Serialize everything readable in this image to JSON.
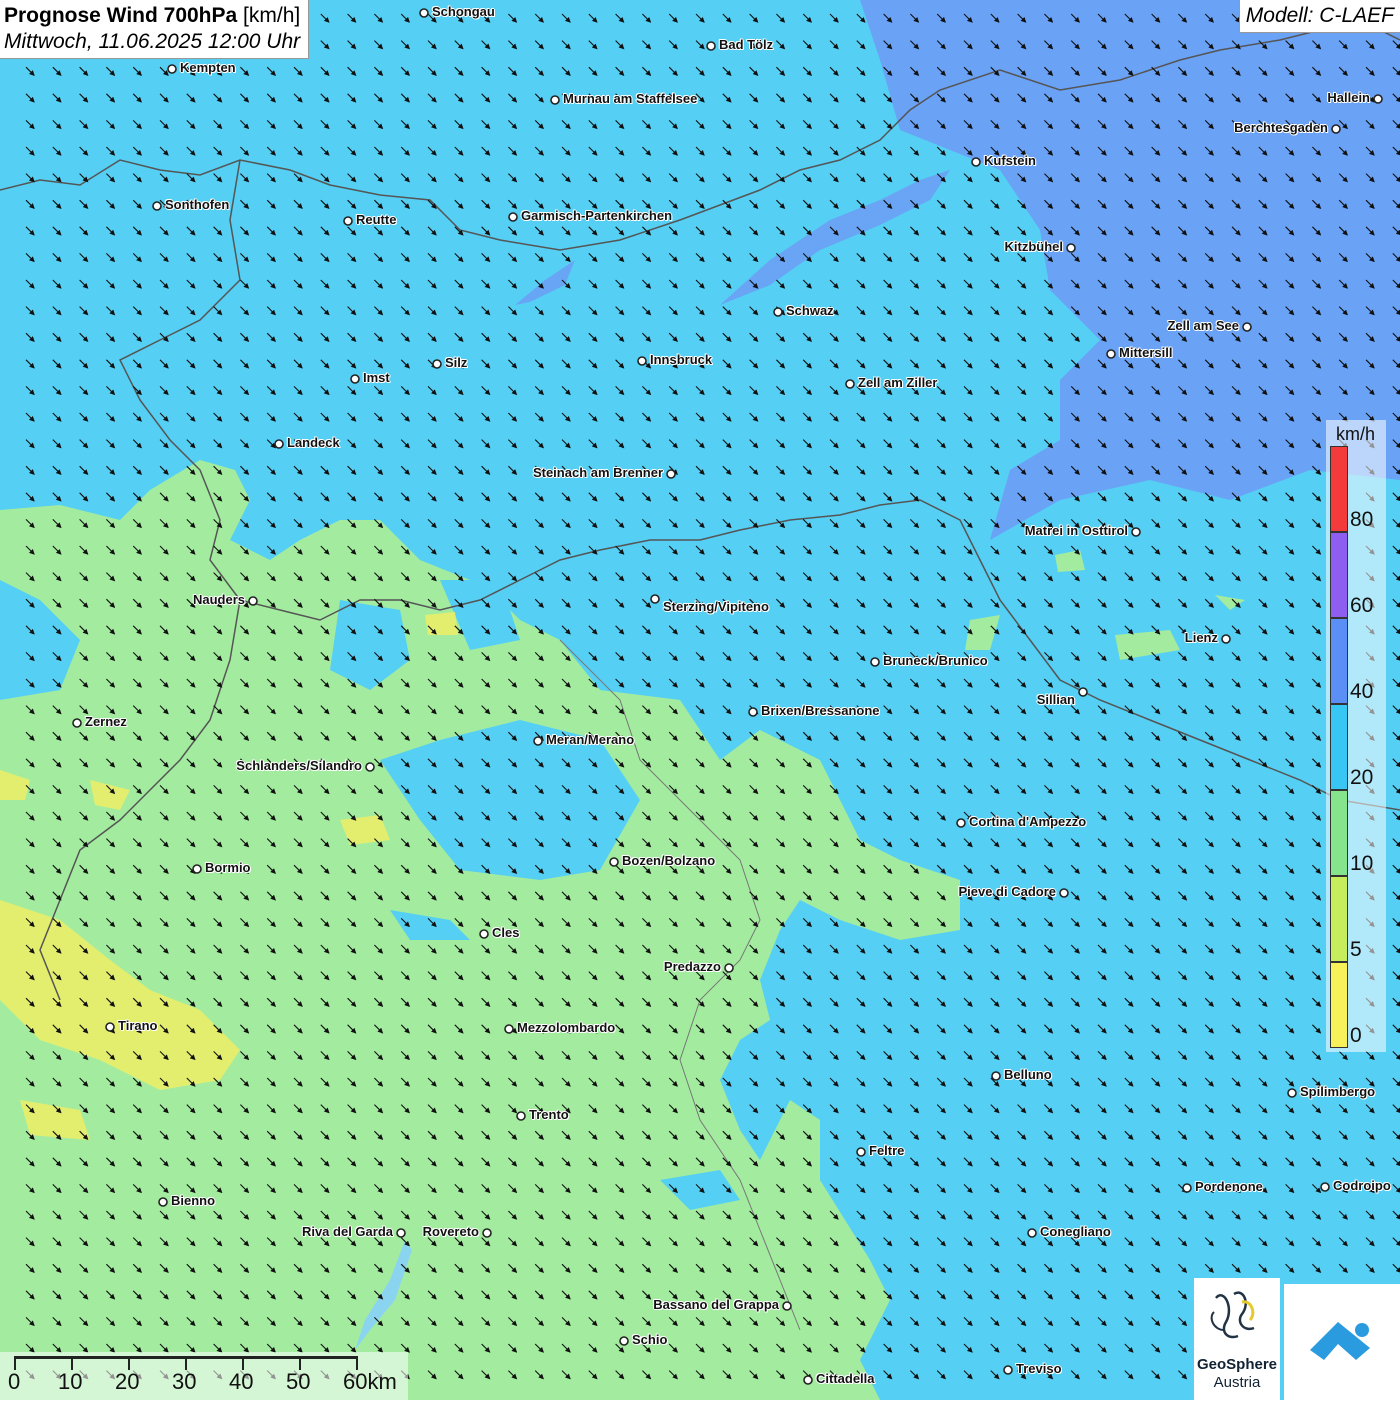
{
  "header": {
    "title_bold": "Prognose Wind 700hPa",
    "title_unit": "[km/h]",
    "subtitle": "Mittwoch, 11.06.2025 12:00 Uhr"
  },
  "model_label": "Modell: C-LAEF",
  "wind_direction": "northwest (arrows pointing to south-east)",
  "legend": {
    "unit": "km/h",
    "classes": [
      {
        "label": "0",
        "color": "#f7f25a"
      },
      {
        "label": "5",
        "color": "#c6ee5c"
      },
      {
        "label": "10",
        "color": "#86e58c"
      },
      {
        "label": "20",
        "color": "#38c6f4"
      },
      {
        "label": "40",
        "color": "#5b8ff6"
      },
      {
        "label": "60",
        "color": "#8d5ef0"
      },
      {
        "label": "80",
        "color": "#f43b3b"
      }
    ]
  },
  "colors": {
    "band_5_10": "#a6ee9f",
    "band_10_20": "#54d0f4",
    "band_20_40": "#6aa6f6",
    "band_0_5": "#e6ef6f"
  },
  "cities": [
    {
      "name": "Schongau"
    },
    {
      "name": "Bad Tölz"
    },
    {
      "name": "Kempten"
    },
    {
      "name": "Murnau am Staffelsee"
    },
    {
      "name": "Hallein"
    },
    {
      "name": "Berchtesgaden"
    },
    {
      "name": "Kufstein"
    },
    {
      "name": "Sonthofen"
    },
    {
      "name": "Reutte"
    },
    {
      "name": "Garmisch-Partenkirchen"
    },
    {
      "name": "Kitzbühel"
    },
    {
      "name": "Schwaz"
    },
    {
      "name": "Zell am See"
    },
    {
      "name": "Mittersill"
    },
    {
      "name": "Innsbruck"
    },
    {
      "name": "Silz"
    },
    {
      "name": "Imst"
    },
    {
      "name": "Zell am Ziller"
    },
    {
      "name": "Landeck"
    },
    {
      "name": "Steinach am Brenner"
    },
    {
      "name": "Matrei in Osttirol"
    },
    {
      "name": "Nauders"
    },
    {
      "name": "Sterzing/Vipiteno"
    },
    {
      "name": "Lienz"
    },
    {
      "name": "Bruneck/Brunico"
    },
    {
      "name": "Sillian"
    },
    {
      "name": "Brixen/Bressanone"
    },
    {
      "name": "Zernez"
    },
    {
      "name": "Meran/Merano"
    },
    {
      "name": "Schlanders/Silandro"
    },
    {
      "name": "Cortina d'Ampezzo"
    },
    {
      "name": "Bozen/Bolzano"
    },
    {
      "name": "Bormio"
    },
    {
      "name": "Pieve di Cadore"
    },
    {
      "name": "Cles"
    },
    {
      "name": "Predazzo"
    },
    {
      "name": "Tirano"
    },
    {
      "name": "Mezzolombardo"
    },
    {
      "name": "Belluno"
    },
    {
      "name": "Spilimbergo"
    },
    {
      "name": "Trento"
    },
    {
      "name": "Feltre"
    },
    {
      "name": "Pordenone"
    },
    {
      "name": "Codroipo"
    },
    {
      "name": "Bienno"
    },
    {
      "name": "Riva del Garda"
    },
    {
      "name": "Rovereto"
    },
    {
      "name": "Conegliano"
    },
    {
      "name": "Bassano del Grappa"
    },
    {
      "name": "Schio"
    },
    {
      "name": "Treviso"
    },
    {
      "name": "Cittadella"
    }
  ],
  "scale_bar": {
    "labels": [
      "0",
      "10",
      "20",
      "30",
      "40",
      "50",
      "60km"
    ]
  },
  "logos": {
    "geosphere_line1": "GeoSphere",
    "geosphere_line2": "Austria"
  }
}
